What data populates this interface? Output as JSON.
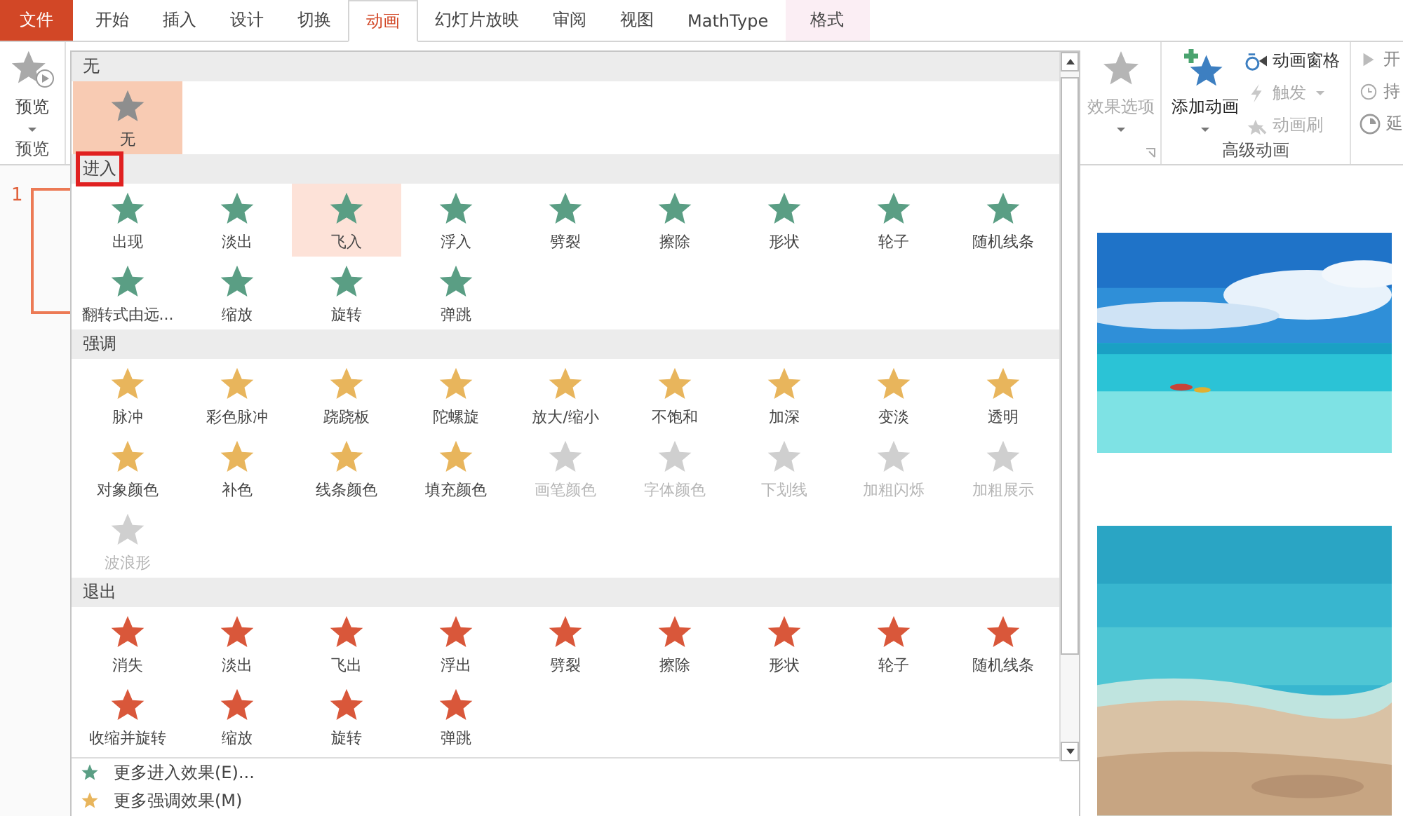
{
  "tabs": [
    {
      "label": "文件",
      "kind": "file",
      "selected": false
    },
    {
      "label": "开始",
      "kind": "normal",
      "selected": false
    },
    {
      "label": "插入",
      "kind": "normal",
      "selected": false
    },
    {
      "label": "设计",
      "kind": "normal",
      "selected": false
    },
    {
      "label": "切换",
      "kind": "normal",
      "selected": false
    },
    {
      "label": "动画",
      "kind": "normal",
      "selected": true
    },
    {
      "label": "幻灯片放映",
      "kind": "normal",
      "selected": false
    },
    {
      "label": "审阅",
      "kind": "normal",
      "selected": false
    },
    {
      "label": "视图",
      "kind": "normal",
      "selected": false
    },
    {
      "label": "MathType",
      "kind": "normal",
      "selected": false
    },
    {
      "label": "格式",
      "kind": "contextual",
      "selected": false
    }
  ],
  "ribbon": {
    "preview": {
      "button": "预览",
      "group_label": "预览"
    },
    "effect_options": {
      "label": "效果选项",
      "disabled": true
    },
    "add_animation": {
      "label": "添加动画"
    },
    "advanced": {
      "group_label": "高级动画",
      "items": [
        {
          "label": "动画窗格",
          "disabled": false,
          "dropdown": false,
          "kind": "pane"
        },
        {
          "label": "触发",
          "disabled": true,
          "dropdown": true,
          "kind": "trigger"
        },
        {
          "label": "动画刷",
          "disabled": true,
          "dropdown": false,
          "kind": "painter"
        }
      ]
    },
    "timing": [
      {
        "label": "开",
        "kind": "start"
      },
      {
        "label": "持",
        "kind": "duration"
      },
      {
        "label": "延",
        "kind": "delay"
      }
    ]
  },
  "slide_pane": {
    "number": "1"
  },
  "gallery": {
    "sections": [
      {
        "title": "无",
        "color": "#8e8e8e",
        "items": [
          {
            "label": "无",
            "selected": true,
            "hovered": false,
            "disabled": false
          }
        ]
      },
      {
        "title": "进入",
        "color": "#5a9e84",
        "items": [
          {
            "label": "出现",
            "selected": false,
            "hovered": false,
            "disabled": false
          },
          {
            "label": "淡出",
            "selected": false,
            "hovered": false,
            "disabled": false
          },
          {
            "label": "飞入",
            "selected": false,
            "hovered": true,
            "disabled": false
          },
          {
            "label": "浮入",
            "selected": false,
            "hovered": false,
            "disabled": false
          },
          {
            "label": "劈裂",
            "selected": false,
            "hovered": false,
            "disabled": false
          },
          {
            "label": "擦除",
            "selected": false,
            "hovered": false,
            "disabled": false
          },
          {
            "label": "形状",
            "selected": false,
            "hovered": false,
            "disabled": false
          },
          {
            "label": "轮子",
            "selected": false,
            "hovered": false,
            "disabled": false
          },
          {
            "label": "随机线条",
            "selected": false,
            "hovered": false,
            "disabled": false
          },
          {
            "label": "翻转式由远...",
            "selected": false,
            "hovered": false,
            "disabled": false
          },
          {
            "label": "缩放",
            "selected": false,
            "hovered": false,
            "disabled": false
          },
          {
            "label": "旋转",
            "selected": false,
            "hovered": false,
            "disabled": false
          },
          {
            "label": "弹跳",
            "selected": false,
            "hovered": false,
            "disabled": false
          }
        ]
      },
      {
        "title": "强调",
        "color": "#e8b55c",
        "items": [
          {
            "label": "脉冲",
            "selected": false,
            "hovered": false,
            "disabled": false
          },
          {
            "label": "彩色脉冲",
            "selected": false,
            "hovered": false,
            "disabled": false
          },
          {
            "label": "跷跷板",
            "selected": false,
            "hovered": false,
            "disabled": false
          },
          {
            "label": "陀螺旋",
            "selected": false,
            "hovered": false,
            "disabled": false
          },
          {
            "label": "放大/缩小",
            "selected": false,
            "hovered": false,
            "disabled": false
          },
          {
            "label": "不饱和",
            "selected": false,
            "hovered": false,
            "disabled": false
          },
          {
            "label": "加深",
            "selected": false,
            "hovered": false,
            "disabled": false
          },
          {
            "label": "变淡",
            "selected": false,
            "hovered": false,
            "disabled": false
          },
          {
            "label": "透明",
            "selected": false,
            "hovered": false,
            "disabled": false
          },
          {
            "label": "对象颜色",
            "selected": false,
            "hovered": false,
            "disabled": false
          },
          {
            "label": "补色",
            "selected": false,
            "hovered": false,
            "disabled": false
          },
          {
            "label": "线条颜色",
            "selected": false,
            "hovered": false,
            "disabled": false
          },
          {
            "label": "填充颜色",
            "selected": false,
            "hovered": false,
            "disabled": false
          },
          {
            "label": "画笔颜色",
            "selected": false,
            "hovered": false,
            "disabled": true
          },
          {
            "label": "字体颜色",
            "selected": false,
            "hovered": false,
            "disabled": true
          },
          {
            "label": "下划线",
            "selected": false,
            "hovered": false,
            "disabled": true
          },
          {
            "label": "加粗闪烁",
            "selected": false,
            "hovered": false,
            "disabled": true
          },
          {
            "label": "加粗展示",
            "selected": false,
            "hovered": false,
            "disabled": true
          },
          {
            "label": "波浪形",
            "selected": false,
            "hovered": false,
            "disabled": true
          }
        ]
      },
      {
        "title": "退出",
        "color": "#d9573a",
        "items": [
          {
            "label": "消失",
            "selected": false,
            "hovered": false,
            "disabled": false
          },
          {
            "label": "淡出",
            "selected": false,
            "hovered": false,
            "disabled": false
          },
          {
            "label": "飞出",
            "selected": false,
            "hovered": false,
            "disabled": false
          },
          {
            "label": "浮出",
            "selected": false,
            "hovered": false,
            "disabled": false
          },
          {
            "label": "劈裂",
            "selected": false,
            "hovered": false,
            "disabled": false
          },
          {
            "label": "擦除",
            "selected": false,
            "hovered": false,
            "disabled": false
          },
          {
            "label": "形状",
            "selected": false,
            "hovered": false,
            "disabled": false
          },
          {
            "label": "轮子",
            "selected": false,
            "hovered": false,
            "disabled": false
          },
          {
            "label": "随机线条",
            "selected": false,
            "hovered": false,
            "disabled": false
          },
          {
            "label": "收缩并旋转",
            "selected": false,
            "hovered": false,
            "disabled": false
          },
          {
            "label": "缩放",
            "selected": false,
            "hovered": false,
            "disabled": false
          },
          {
            "label": "旋转",
            "selected": false,
            "hovered": false,
            "disabled": false
          },
          {
            "label": "弹跳",
            "selected": false,
            "hovered": false,
            "disabled": false
          }
        ]
      }
    ],
    "more": [
      {
        "label": "更多进入效果(E)...",
        "color": "#5a9e84"
      },
      {
        "label": "更多强调效果(M)",
        "color": "#e8b55c"
      }
    ]
  }
}
